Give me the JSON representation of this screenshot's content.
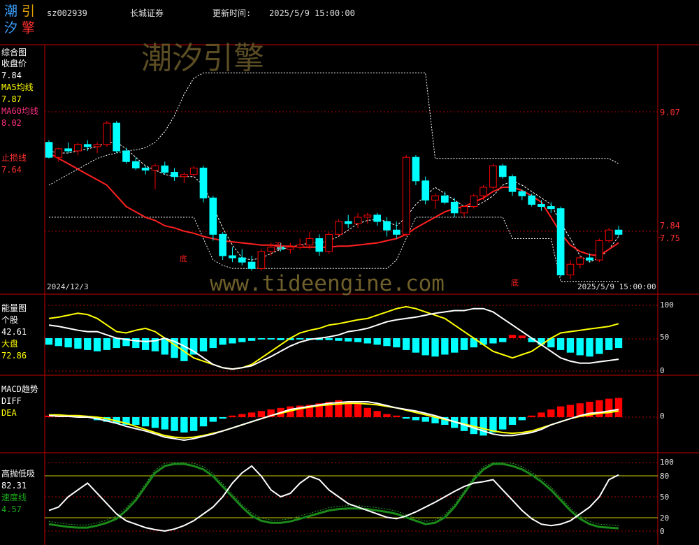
{
  "header": {
    "logo_chars": [
      "潮",
      "引",
      "汐",
      "擎"
    ],
    "code": "sz002939",
    "name": "长城证券",
    "update_label": "更新时间:",
    "update_time": "2025/5/9 15:00:00"
  },
  "watermarks": {
    "top": "潮汐引擎",
    "url": "www.tideengine.com"
  },
  "colors": {
    "frame": "#c00000",
    "up": "#ff0000",
    "down": "#00ffff",
    "ma5": "#ffffff",
    "ma60": "#ff2020",
    "yellow": "#ffff00",
    "green": "#1a8a1a"
  },
  "panels": {
    "main": {
      "title": "综合图",
      "legend": [
        {
          "label": "收盘价",
          "value": "7.84"
        },
        {
          "label": "MA5均线",
          "value": "7.87"
        },
        {
          "label": "MA60均线",
          "value": "8.02"
        },
        {
          "label": "止损线",
          "value": "7.64"
        }
      ],
      "y_labels": [
        "9.07",
        "7.84",
        "7.75"
      ],
      "date_start": "2024/12/3",
      "date_end": "2025/5/9  15:00:00",
      "markers": [
        "底",
        "强",
        "底"
      ]
    },
    "energy": {
      "title": "能量图",
      "legend": [
        {
          "label": "个股",
          "value": "42.61"
        },
        {
          "label": "大盘",
          "value": "72.86"
        }
      ],
      "y_labels": [
        "100",
        "50",
        "0"
      ]
    },
    "macd": {
      "title": "MACD趋势",
      "legend": [
        {
          "label": "DIFF"
        },
        {
          "label": "DEA"
        }
      ],
      "y_labels": [
        "0"
      ]
    },
    "osc": {
      "title": "高抛低吸",
      "legend": [
        {
          "label": "",
          "value": "82.31"
        },
        {
          "label": "速度线",
          "value": "4.57"
        }
      ],
      "y_labels": [
        "100",
        "80",
        "50",
        "20",
        "0"
      ]
    }
  },
  "chart_data": {
    "type": "candlestick",
    "n": 60,
    "ylim": [
      7.3,
      9.6
    ],
    "ohlc": [
      [
        8.7,
        8.72,
        8.55,
        8.56
      ],
      [
        8.56,
        8.65,
        8.52,
        8.64
      ],
      [
        8.64,
        8.7,
        8.6,
        8.62
      ],
      [
        8.62,
        8.7,
        8.58,
        8.68
      ],
      [
        8.68,
        8.72,
        8.62,
        8.66
      ],
      [
        8.66,
        8.7,
        8.6,
        8.68
      ],
      [
        8.68,
        8.9,
        8.66,
        8.88
      ],
      [
        8.88,
        8.9,
        8.6,
        8.62
      ],
      [
        8.62,
        8.65,
        8.5,
        8.52
      ],
      [
        8.52,
        8.56,
        8.44,
        8.46
      ],
      [
        8.46,
        8.48,
        8.4,
        8.44
      ],
      [
        8.44,
        8.5,
        8.26,
        8.48
      ],
      [
        8.48,
        8.52,
        8.4,
        8.42
      ],
      [
        8.42,
        8.46,
        8.34,
        8.38
      ],
      [
        8.38,
        8.42,
        8.32,
        8.4
      ],
      [
        8.4,
        8.48,
        8.38,
        8.46
      ],
      [
        8.46,
        8.48,
        8.14,
        8.18
      ],
      [
        8.18,
        8.2,
        7.78,
        7.84
      ],
      [
        7.84,
        7.86,
        7.6,
        7.64
      ],
      [
        7.64,
        7.72,
        7.58,
        7.62
      ],
      [
        7.62,
        7.7,
        7.55,
        7.58
      ],
      [
        7.58,
        7.64,
        7.5,
        7.52
      ],
      [
        7.52,
        7.7,
        7.5,
        7.68
      ],
      [
        7.68,
        7.76,
        7.64,
        7.72
      ],
      [
        7.72,
        7.76,
        7.68,
        7.7
      ],
      [
        7.7,
        7.76,
        7.66,
        7.72
      ],
      [
        7.72,
        7.8,
        7.7,
        7.74
      ],
      [
        7.74,
        7.86,
        7.7,
        7.8
      ],
      [
        7.8,
        7.84,
        7.64,
        7.68
      ],
      [
        7.68,
        7.86,
        7.66,
        7.84
      ],
      [
        7.84,
        7.98,
        7.82,
        7.96
      ],
      [
        7.96,
        8.02,
        7.9,
        7.94
      ],
      [
        7.94,
        8.04,
        7.9,
        8.0
      ],
      [
        8.0,
        8.04,
        7.94,
        8.02
      ],
      [
        8.02,
        8.04,
        7.92,
        7.96
      ],
      [
        7.96,
        8.0,
        7.82,
        7.88
      ],
      [
        7.88,
        7.96,
        7.8,
        7.84
      ],
      [
        7.84,
        8.58,
        7.82,
        8.56
      ],
      [
        8.56,
        8.58,
        8.3,
        8.34
      ],
      [
        8.34,
        8.38,
        8.12,
        8.16
      ],
      [
        8.16,
        8.22,
        8.08,
        8.2
      ],
      [
        8.2,
        8.24,
        8.12,
        8.14
      ],
      [
        8.14,
        8.18,
        8.0,
        8.04
      ],
      [
        8.04,
        8.1,
        8.0,
        8.1
      ],
      [
        8.1,
        8.22,
        8.08,
        8.2
      ],
      [
        8.2,
        8.3,
        8.16,
        8.28
      ],
      [
        8.28,
        8.5,
        8.26,
        8.48
      ],
      [
        8.48,
        8.5,
        8.36,
        8.38
      ],
      [
        8.38,
        8.4,
        8.2,
        8.24
      ],
      [
        8.24,
        8.26,
        8.16,
        8.2
      ],
      [
        8.2,
        8.22,
        8.1,
        8.12
      ],
      [
        8.12,
        8.16,
        8.06,
        8.1
      ],
      [
        8.1,
        8.14,
        8.04,
        8.08
      ],
      [
        8.08,
        8.1,
        7.44,
        7.46
      ],
      [
        7.46,
        7.6,
        7.42,
        7.56
      ],
      [
        7.56,
        7.64,
        7.52,
        7.62
      ],
      [
        7.62,
        7.66,
        7.58,
        7.6
      ],
      [
        7.6,
        7.8,
        7.58,
        7.78
      ],
      [
        7.78,
        7.9,
        7.76,
        7.88
      ],
      [
        7.88,
        7.92,
        7.82,
        7.84
      ]
    ],
    "ma60": [
      8.6,
      8.55,
      8.5,
      8.45,
      8.4,
      8.35,
      8.3,
      8.2,
      8.1,
      8.05,
      8.0,
      7.97,
      7.92,
      7.9,
      7.87,
      7.85,
      7.82,
      7.8,
      7.78,
      7.77,
      7.76,
      7.75,
      7.74,
      7.74,
      7.73,
      7.73,
      7.72,
      7.72,
      7.72,
      7.72,
      7.73,
      7.73,
      7.74,
      7.75,
      7.76,
      7.78,
      7.8,
      7.84,
      7.9,
      7.95,
      8.0,
      8.05,
      8.08,
      8.1,
      8.14,
      8.18,
      8.24,
      8.28,
      8.28,
      8.25,
      8.2,
      8.14,
      8.0,
      7.85,
      7.74,
      7.68,
      7.65,
      7.64,
      7.7,
      7.76
    ],
    "ma5": [
      8.62,
      8.6,
      8.6,
      8.62,
      8.64,
      8.66,
      8.7,
      8.7,
      8.64,
      8.56,
      8.48,
      8.44,
      8.4,
      8.38,
      8.38,
      8.38,
      8.3,
      8.1,
      7.9,
      7.74,
      7.62,
      7.6,
      7.62,
      7.66,
      7.7,
      7.72,
      7.74,
      7.76,
      7.76,
      7.78,
      7.82,
      7.88,
      7.94,
      7.97,
      7.98,
      7.96,
      7.92,
      8.0,
      8.12,
      8.2,
      8.28,
      8.22,
      8.16,
      8.1,
      8.1,
      8.14,
      8.2,
      8.3,
      8.34,
      8.3,
      8.24,
      8.18,
      8.12,
      7.95,
      7.8,
      7.64,
      7.58,
      7.62,
      7.7,
      7.82
    ],
    "stop_upper": [
      8.3,
      8.35,
      8.4,
      8.45,
      8.5,
      8.55,
      8.58,
      8.6,
      8.62,
      8.63,
      8.65,
      8.7,
      8.8,
      8.95,
      9.15,
      9.3,
      9.35,
      9.35,
      9.35,
      9.35,
      9.35,
      9.35,
      9.35,
      9.35,
      9.35,
      9.35,
      9.35,
      9.35,
      9.35,
      9.35,
      9.35,
      9.35,
      9.35,
      9.35,
      9.35,
      9.35,
      9.35,
      9.35,
      9.35,
      9.35,
      8.55,
      8.55,
      8.55,
      8.55,
      8.55,
      8.55,
      8.55,
      8.55,
      8.55,
      8.55,
      8.55,
      8.55,
      8.55,
      8.55,
      8.55,
      8.55,
      8.55,
      8.55,
      8.55,
      8.5
    ],
    "stop_lower": [
      8.0,
      8.0,
      8.0,
      8.0,
      8.0,
      8.0,
      8.0,
      8.0,
      8.0,
      8.0,
      8.0,
      8.0,
      8.0,
      8.0,
      8.0,
      8.0,
      7.8,
      7.6,
      7.55,
      7.52,
      7.52,
      7.52,
      7.52,
      7.52,
      7.52,
      7.52,
      7.52,
      7.52,
      7.52,
      7.52,
      7.52,
      7.52,
      7.52,
      7.52,
      7.52,
      7.52,
      7.6,
      7.8,
      8.0,
      8.0,
      8.0,
      8.0,
      8.0,
      8.0,
      8.0,
      8.0,
      8.0,
      8.0,
      7.8,
      7.8,
      7.8,
      7.8,
      7.8,
      7.4,
      7.4,
      7.4,
      7.4,
      7.4,
      7.4,
      7.4
    ],
    "energy_stock": [
      70,
      68,
      65,
      62,
      60,
      60,
      55,
      50,
      48,
      46,
      45,
      46,
      50,
      45,
      38,
      30,
      20,
      10,
      5,
      3,
      5,
      8,
      15,
      22,
      30,
      38,
      44,
      48,
      50,
      52,
      55,
      60,
      62,
      65,
      70,
      75,
      78,
      80,
      82,
      85,
      88,
      90,
      92,
      92,
      95,
      95,
      90,
      80,
      70,
      60,
      50,
      40,
      30,
      20,
      15,
      12,
      12,
      14,
      16,
      18
    ],
    "energy_index": [
      80,
      82,
      85,
      88,
      86,
      80,
      70,
      60,
      58,
      62,
      65,
      60,
      50,
      40,
      30,
      20,
      15,
      10,
      5,
      3,
      5,
      10,
      20,
      30,
      40,
      50,
      58,
      62,
      65,
      70,
      72,
      75,
      78,
      80,
      85,
      90,
      95,
      98,
      95,
      90,
      85,
      80,
      70,
      60,
      50,
      40,
      30,
      25,
      20,
      25,
      30,
      40,
      50,
      58,
      60,
      62,
      64,
      66,
      68,
      72
    ],
    "energy_bars": [
      -10,
      -12,
      -14,
      -16,
      -18,
      -20,
      -18,
      -15,
      -12,
      -15,
      -18,
      -20,
      -25,
      -30,
      -35,
      -25,
      -20,
      -15,
      -10,
      -8,
      -6,
      -4,
      -2,
      -2,
      -3,
      -3,
      -2,
      -2,
      -3,
      -3,
      -4,
      -5,
      -6,
      -8,
      -10,
      -12,
      -14,
      -18,
      -22,
      -26,
      -28,
      -25,
      -22,
      -18,
      -14,
      -10,
      -8,
      -6,
      5,
      4,
      -6,
      -10,
      -14,
      -18,
      -22,
      -26,
      -28,
      -24,
      -18,
      -15
    ],
    "macd_diff": [
      0.02,
      0.01,
      0.01,
      0.0,
      0.0,
      -0.02,
      -0.05,
      -0.08,
      -0.12,
      -0.15,
      -0.18,
      -0.22,
      -0.26,
      -0.28,
      -0.3,
      -0.28,
      -0.25,
      -0.22,
      -0.18,
      -0.14,
      -0.1,
      -0.06,
      -0.02,
      0.02,
      0.06,
      0.1,
      0.12,
      0.14,
      0.16,
      0.18,
      0.19,
      0.2,
      0.2,
      0.2,
      0.18,
      0.15,
      0.12,
      0.1,
      0.08,
      0.05,
      0.02,
      -0.02,
      -0.06,
      -0.1,
      -0.14,
      -0.18,
      -0.22,
      -0.24,
      -0.24,
      -0.22,
      -0.2,
      -0.16,
      -0.1,
      -0.06,
      -0.02,
      0.02,
      0.05,
      0.06,
      0.08,
      0.1
    ],
    "macd_dea": [
      0.03,
      0.03,
      0.02,
      0.02,
      0.01,
      0.0,
      -0.02,
      -0.05,
      -0.08,
      -0.12,
      -0.16,
      -0.2,
      -0.24,
      -0.26,
      -0.27,
      -0.26,
      -0.24,
      -0.21,
      -0.18,
      -0.14,
      -0.1,
      -0.06,
      -0.02,
      0.02,
      0.05,
      0.08,
      0.11,
      0.13,
      0.15,
      0.16,
      0.17,
      0.18,
      0.18,
      0.17,
      0.16,
      0.14,
      0.12,
      0.09,
      0.06,
      0.03,
      0.0,
      -0.03,
      -0.06,
      -0.09,
      -0.12,
      -0.15,
      -0.18,
      -0.2,
      -0.21,
      -0.2,
      -0.18,
      -0.14,
      -0.1,
      -0.06,
      -0.02,
      0.01,
      0.03,
      0.05,
      0.06,
      0.08
    ],
    "macd_hist": [
      0.02,
      0.02,
      0.01,
      0.01,
      0.0,
      -0.04,
      -0.06,
      -0.08,
      -0.1,
      -0.1,
      -0.12,
      -0.14,
      -0.16,
      -0.18,
      -0.2,
      -0.18,
      -0.12,
      -0.06,
      -0.02,
      0.02,
      0.04,
      0.06,
      0.08,
      0.1,
      0.12,
      0.14,
      0.15,
      0.16,
      0.18,
      0.2,
      0.22,
      0.2,
      0.18,
      0.12,
      0.08,
      0.04,
      0.02,
      -0.02,
      -0.04,
      -0.06,
      -0.08,
      -0.1,
      -0.14,
      -0.18,
      -0.22,
      -0.24,
      -0.2,
      -0.16,
      -0.1,
      -0.04,
      0.02,
      0.06,
      0.1,
      0.14,
      0.16,
      0.18,
      0.2,
      0.22,
      0.24,
      0.25
    ],
    "osc_white": [
      30,
      35,
      50,
      60,
      70,
      55,
      40,
      25,
      15,
      10,
      5,
      2,
      0,
      3,
      8,
      15,
      25,
      35,
      50,
      70,
      85,
      95,
      80,
      60,
      50,
      55,
      70,
      80,
      75,
      60,
      50,
      40,
      35,
      30,
      25,
      20,
      18,
      22,
      28,
      35,
      42,
      50,
      58,
      65,
      70,
      72,
      75,
      60,
      45,
      30,
      18,
      10,
      8,
      10,
      15,
      25,
      35,
      50,
      75,
      82
    ],
    "osc_green": [
      10,
      8,
      6,
      5,
      5,
      8,
      12,
      18,
      30,
      45,
      65,
      85,
      95,
      98,
      98,
      95,
      90,
      80,
      65,
      50,
      35,
      22,
      15,
      12,
      12,
      14,
      18,
      22,
      26,
      30,
      32,
      33,
      33,
      32,
      30,
      28,
      25,
      20,
      15,
      10,
      12,
      20,
      35,
      55,
      75,
      90,
      98,
      98,
      95,
      90,
      82,
      72,
      60,
      45,
      30,
      18,
      10,
      6,
      5,
      4
    ]
  }
}
